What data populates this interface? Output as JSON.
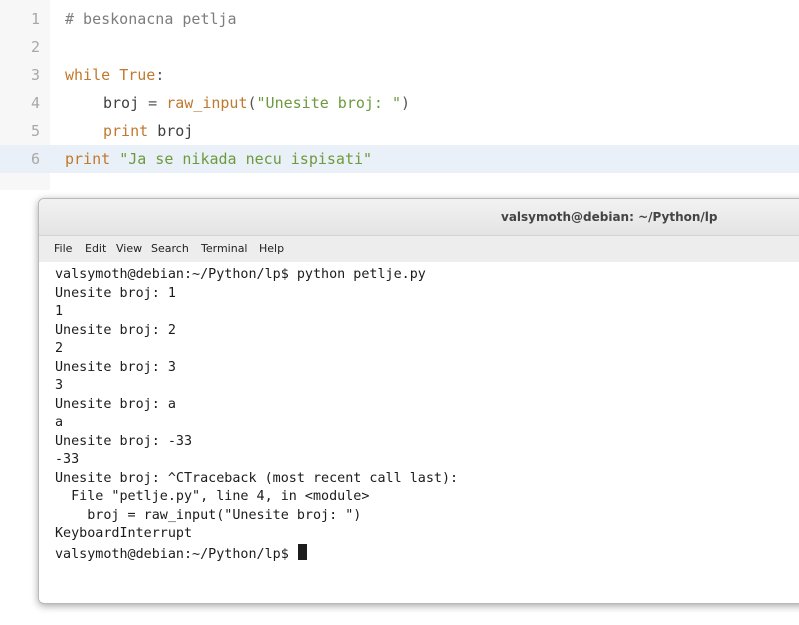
{
  "editor": {
    "line_numbers": [
      "1",
      "2",
      "3",
      "4",
      "5",
      "6"
    ],
    "line1": {
      "comment": "# beskonacna petlja"
    },
    "line3": {
      "kw": "while",
      "value": "True",
      "colon": ":"
    },
    "line4": {
      "var": "broj",
      "eq": " = ",
      "func": "raw_input",
      "open": "(",
      "str": "\"Unesite broj: \"",
      "close": ")"
    },
    "line5": {
      "kw": "print",
      "var": "broj"
    },
    "line6": {
      "kw": "print",
      "str": "\"Ja se nikada necu ispisati\""
    }
  },
  "terminal": {
    "title": "valsymoth@debian: ~/Python/lp",
    "menu": [
      "File",
      "Edit",
      "View",
      "Search",
      "Terminal",
      "Help"
    ],
    "lines": [
      "valsymoth@debian:~/Python/lp$ python petlje.py",
      "Unesite broj: 1",
      "1",
      "Unesite broj: 2",
      "2",
      "Unesite broj: 3",
      "3",
      "Unesite broj: a",
      "a",
      "Unesite broj: -33",
      "-33",
      "Unesite broj: ^CTraceback (most recent call last):",
      "  File \"petlje.py\", line 4, in <module>",
      "    broj = raw_input(\"Unesite broj: \")",
      "KeyboardInterrupt"
    ],
    "prompt": "valsymoth@debian:~/Python/lp$ "
  }
}
